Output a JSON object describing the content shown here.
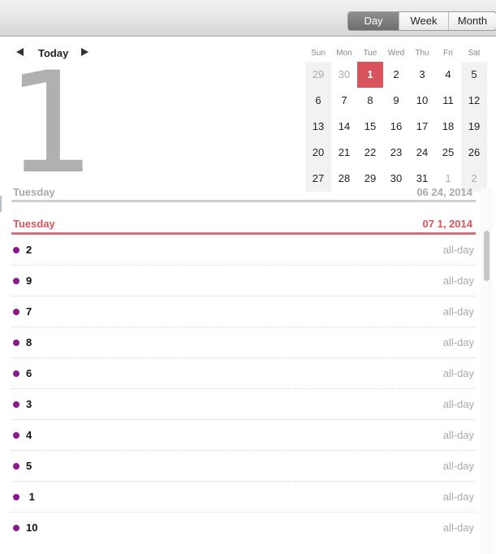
{
  "toolbar": {
    "views": [
      {
        "label": "Day",
        "active": true
      },
      {
        "label": "Week",
        "active": false
      },
      {
        "label": "Month",
        "active": false
      }
    ]
  },
  "nav": {
    "prev_icon": "triangle-left-icon",
    "today_label": "Today",
    "next_icon": "triangle-right-icon"
  },
  "big_day": "1",
  "mini_calendar": {
    "weekdays": [
      "Sun",
      "Mon",
      "Tue",
      "Wed",
      "Thu",
      "Fri",
      "Sat"
    ],
    "weeks": [
      [
        "29",
        "30",
        "1",
        "2",
        "3",
        "4",
        "5"
      ],
      [
        "6",
        "7",
        "8",
        "9",
        "10",
        "11",
        "12"
      ],
      [
        "13",
        "14",
        "15",
        "16",
        "17",
        "18",
        "19"
      ],
      [
        "20",
        "21",
        "22",
        "23",
        "24",
        "25",
        "26"
      ],
      [
        "27",
        "28",
        "29",
        "30",
        "31",
        "1",
        "2"
      ]
    ],
    "selected": "1",
    "selected_color": "#d9535d"
  },
  "day_list": {
    "previous_header": {
      "weekday": "Tuesday",
      "date": "06 24, 2014"
    },
    "current_header": {
      "weekday": "Tuesday",
      "date": "07 1, 2014"
    },
    "accent_color": "#d9535d",
    "event_dot_color": "#8a1a8c",
    "events": [
      {
        "name": "2",
        "time": "all-day"
      },
      {
        "name": "9",
        "time": "all-day"
      },
      {
        "name": "7",
        "time": "all-day"
      },
      {
        "name": "8",
        "time": "all-day"
      },
      {
        "name": "6",
        "time": "all-day"
      },
      {
        "name": "3",
        "time": "all-day"
      },
      {
        "name": "4",
        "time": "all-day"
      },
      {
        "name": "5",
        "time": "all-day"
      },
      {
        "name": " 1",
        "time": "all-day"
      },
      {
        "name": "10",
        "time": "all-day"
      }
    ]
  }
}
